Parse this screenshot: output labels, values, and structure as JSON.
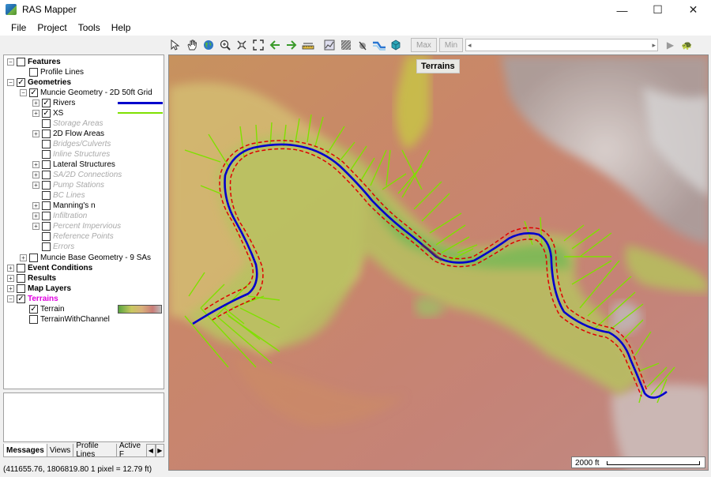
{
  "window": {
    "title": "RAS Mapper"
  },
  "window_controls": {
    "minimize": "—",
    "maximize": "☐",
    "close": "✕"
  },
  "menu": [
    "File",
    "Project",
    "Tools",
    "Help"
  ],
  "toolbar": {
    "max_label": "Max",
    "min_label": "Min"
  },
  "tree": {
    "features": "Features",
    "profile_lines": "Profile Lines",
    "geometries": "Geometries",
    "muncie_geometry": "Muncie Geometry - 2D 50ft Grid",
    "rivers": "Rivers",
    "xs": "XS",
    "storage_areas": "Storage Areas",
    "flow_areas_2d": "2D Flow Areas",
    "bridges_culverts": "Bridges/Culverts",
    "inline_structures": "Inline Structures",
    "lateral_structures": "Lateral Structures",
    "sa_2d_connections": "SA/2D Connections",
    "pump_stations": "Pump Stations",
    "bc_lines": "BC Lines",
    "mannings_n": "Manning's n",
    "infiltration": "Infiltration",
    "percent_impervious": "Percent Impervious",
    "reference_points": "Reference Points",
    "errors": "Errors",
    "muncie_base": "Muncie Base Geometry - 9 SAs",
    "event_conditions": "Event Conditions",
    "results": "Results",
    "map_layers": "Map Layers",
    "terrains": "Terrains",
    "terrain": "Terrain",
    "terrain_with_channel": "TerrainWithChannel"
  },
  "tabs": [
    "Messages",
    "Views",
    "Profile Lines",
    "Active F"
  ],
  "status": {
    "coords": "(411655.76, 1806819.80  1 pixel = 12.79 ft)"
  },
  "map": {
    "label": "Terrains",
    "scale": "2000 ft"
  },
  "colors": {
    "river": "#0000cc",
    "xs": "#7fe000",
    "bank": "#e00000",
    "terrains_label": "#e000e0"
  }
}
